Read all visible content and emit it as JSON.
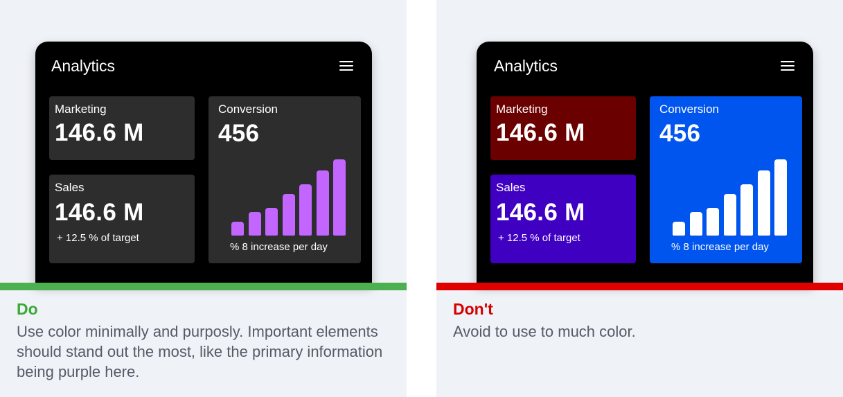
{
  "do_example": {
    "verdict": "Do",
    "guideline": "Use color minimally and purposly. Important elements should stand out the most, like the primary information being purple here.",
    "colors": {
      "accent": "#c266ff",
      "card_bg": "#2d2d2d",
      "strip": "#4caf50",
      "verdict": "#3aaa35"
    },
    "app": {
      "title": "Analytics",
      "menu_icon": "hamburger-menu-icon",
      "marketing": {
        "label": "Marketing",
        "value": "146.6 M"
      },
      "sales": {
        "label": "Sales",
        "value": "146.6 M",
        "note": "+ 12.5 % of target"
      },
      "conversion": {
        "label": "Conversion",
        "value": "456",
        "note": "% 8 increase per day"
      }
    }
  },
  "dont_example": {
    "verdict": "Don't",
    "guideline": "Avoid to use to much color.",
    "colors": {
      "marketing_bg": "#6b0000",
      "sales_bg": "#3f00c2",
      "conversion_bg": "#0055ee",
      "strip": "#e00000",
      "verdict": "#d50000"
    },
    "app": {
      "title": "Analytics",
      "menu_icon": "hamburger-menu-icon",
      "marketing": {
        "label": "Marketing",
        "value": "146.6 M"
      },
      "sales": {
        "label": "Sales",
        "value": "146.6 M",
        "note": "+ 12.5 % of target"
      },
      "conversion": {
        "label": "Conversion",
        "value": "456",
        "note": "% 8 increase per day"
      }
    }
  },
  "sparkline_values": [
    20,
    34,
    40,
    60,
    74,
    94,
    110
  ]
}
